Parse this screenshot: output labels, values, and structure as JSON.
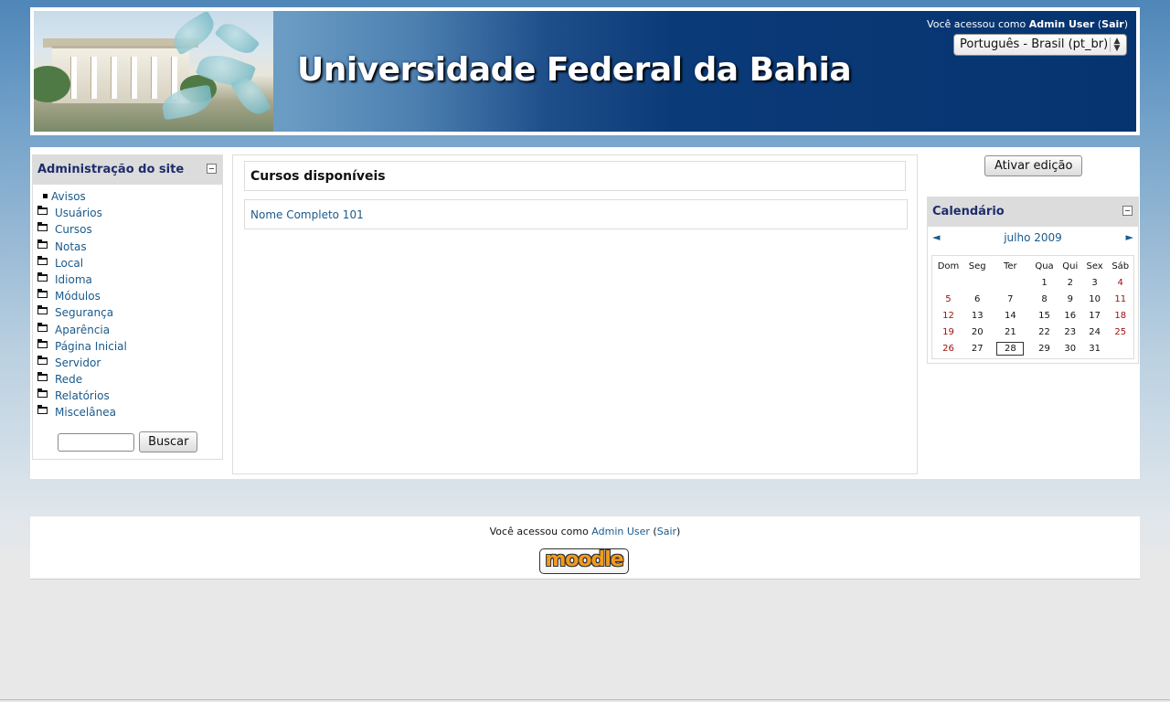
{
  "header": {
    "site_title": "Universidade Federal da Bahia",
    "login_prefix": "Você acessou como",
    "user_name": "Admin User",
    "logout_label": "Sair",
    "language_selected": "Português - Brasil (pt_br)"
  },
  "admin_block": {
    "title": "Administração do site",
    "items": [
      {
        "label": "Avisos",
        "icon": "bullet-icon"
      },
      {
        "label": "Usuários",
        "icon": "folder-icon"
      },
      {
        "label": "Cursos",
        "icon": "folder-icon"
      },
      {
        "label": "Notas",
        "icon": "folder-icon"
      },
      {
        "label": "Local",
        "icon": "folder-icon"
      },
      {
        "label": "Idioma",
        "icon": "folder-icon"
      },
      {
        "label": "Módulos",
        "icon": "folder-icon"
      },
      {
        "label": "Segurança",
        "icon": "folder-icon"
      },
      {
        "label": "Aparência",
        "icon": "folder-icon"
      },
      {
        "label": "Página Inicial",
        "icon": "folder-icon"
      },
      {
        "label": "Servidor",
        "icon": "folder-icon"
      },
      {
        "label": "Rede",
        "icon": "folder-icon"
      },
      {
        "label": "Relatórios",
        "icon": "folder-icon"
      },
      {
        "label": "Miscelânea",
        "icon": "folder-icon"
      }
    ],
    "search_value": "",
    "search_button": "Buscar"
  },
  "main": {
    "courses_title": "Cursos disponíveis",
    "courses": [
      "Nome Completo 101"
    ]
  },
  "right": {
    "edit_button": "Ativar edição",
    "calendar": {
      "title": "Calendário",
      "prev": "◄",
      "next": "►",
      "month": "julho 2009",
      "weekdays": [
        "Dom",
        "Seg",
        "Ter",
        "Qua",
        "Qui",
        "Sex",
        "Sáb"
      ],
      "weeks": [
        [
          "",
          "",
          "",
          "1",
          "2",
          "3",
          "4"
        ],
        [
          "5",
          "6",
          "7",
          "8",
          "9",
          "10",
          "11"
        ],
        [
          "12",
          "13",
          "14",
          "15",
          "16",
          "17",
          "18"
        ],
        [
          "19",
          "20",
          "21",
          "22",
          "23",
          "24",
          "25"
        ],
        [
          "26",
          "27",
          "28",
          "29",
          "30",
          "31",
          ""
        ]
      ],
      "today": "28"
    }
  },
  "footer": {
    "login_prefix": "Você acessou como",
    "user_name": "Admin User",
    "logout_label": "Sair",
    "logo_text": "moodle"
  },
  "colors": {
    "link": "#1a5a8c",
    "block_title": "#1e2d6b",
    "weekend": "#a01010",
    "banner_dark": "#063470"
  }
}
